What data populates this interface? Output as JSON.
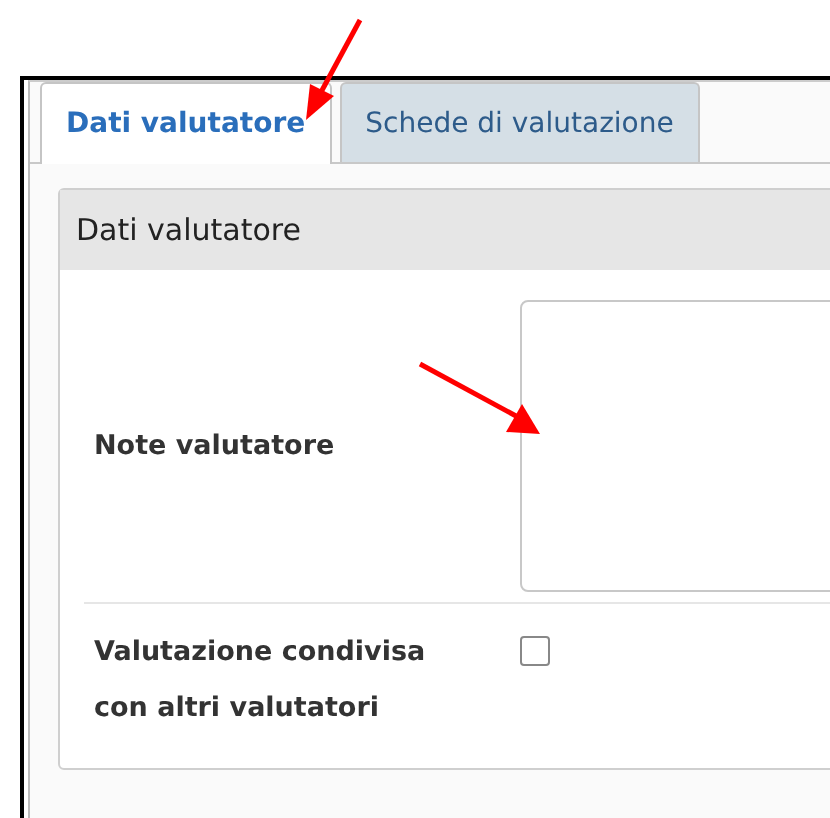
{
  "tabs": [
    {
      "label": "Dati valutatore",
      "selected": true
    },
    {
      "label": "Schede di valutazione",
      "selected": false
    }
  ],
  "panel": {
    "title": "Dati valutatore",
    "fields": [
      {
        "kind": "textarea",
        "label": "Note valutatore"
      },
      {
        "kind": "checkbox",
        "label": "Valutazione condivisa con altri valutatori",
        "checked": false
      }
    ]
  }
}
